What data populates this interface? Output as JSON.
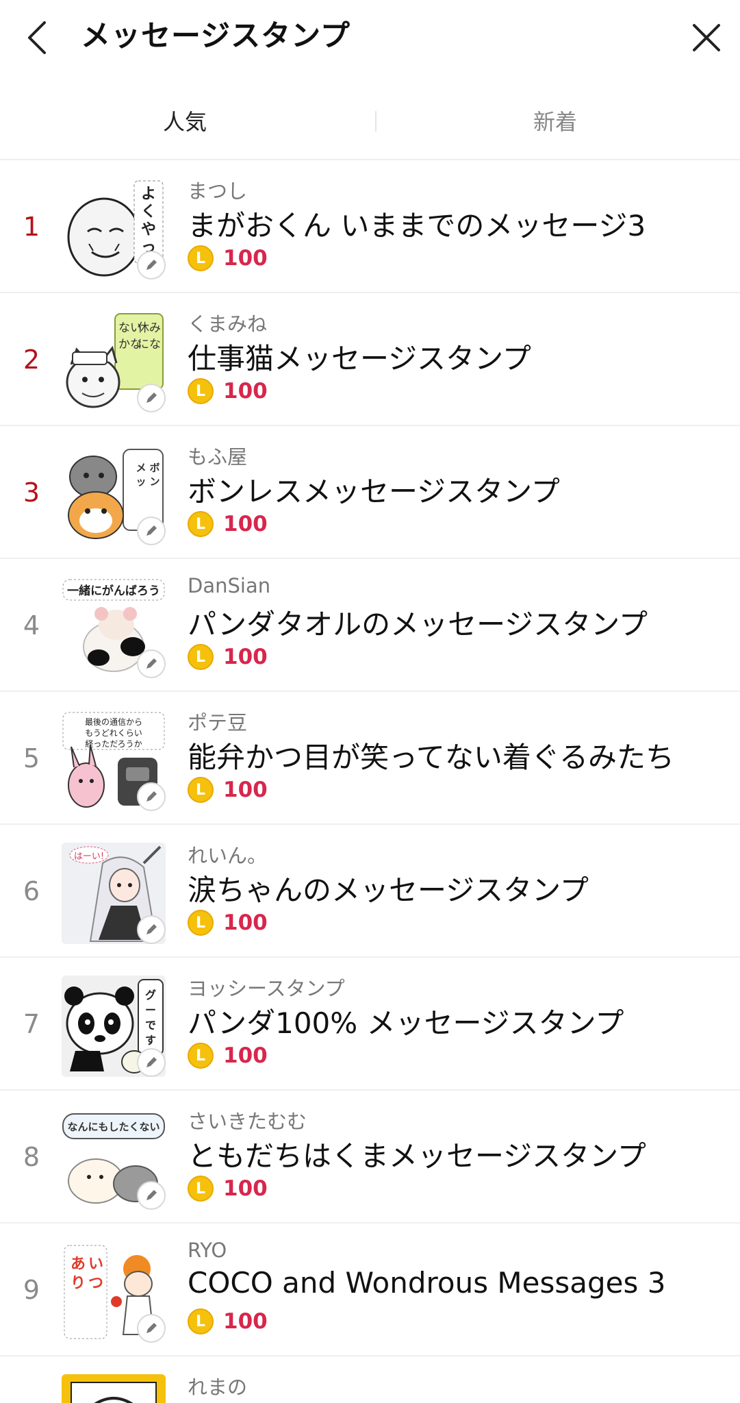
{
  "header": {
    "title": "メッセージスタンプ"
  },
  "tabs": [
    {
      "label": "人気",
      "active": true
    },
    {
      "label": "新着",
      "active": false
    }
  ],
  "colors": {
    "rank_top": "#b5121b",
    "rank_default": "#8a8a8a",
    "price": "#d8264c",
    "coin": "#f6c10c"
  },
  "items": [
    {
      "rank": "1",
      "author": "まつし",
      "name": "まがおくん いままでのメッセージ3",
      "price": "100",
      "coin_symbol": "L",
      "thumb": "bald-face-sticker"
    },
    {
      "rank": "2",
      "author": "くまみね",
      "name": "仕事猫メッセージスタンプ",
      "price": "100",
      "coin_symbol": "L",
      "thumb": "work-cat-sticker"
    },
    {
      "rank": "3",
      "author": "もふ屋",
      "name": "ボンレスメッセージスタンプ",
      "price": "100",
      "coin_symbol": "L",
      "thumb": "boneless-cat-sticker"
    },
    {
      "rank": "4",
      "author": "DanSian",
      "name": "パンダタオルのメッセージスタンプ",
      "price": "100",
      "coin_symbol": "L",
      "thumb": "panda-towel-sticker"
    },
    {
      "rank": "5",
      "author": "ポテ豆",
      "name": "能弁かつ目が笑ってない着ぐるみたち",
      "price": "100",
      "coin_symbol": "L",
      "thumb": "costume-rabbit-sticker"
    },
    {
      "rank": "6",
      "author": "れいん。",
      "name": "涙ちゃんのメッセージスタンプ",
      "price": "100",
      "coin_symbol": "L",
      "thumb": "anime-girl-sticker"
    },
    {
      "rank": "7",
      "author": "ヨッシースタンプ",
      "name": "パンダ100% メッセージスタンプ",
      "price": "100",
      "coin_symbol": "L",
      "thumb": "panda-sticker"
    },
    {
      "rank": "8",
      "author": "さいきたむむ",
      "name": "ともだちはくまメッセージスタンプ",
      "price": "100",
      "coin_symbol": "L",
      "thumb": "bear-friend-sticker"
    },
    {
      "rank": "9",
      "author": "RYO",
      "name": "COCO and Wondrous Messages 3",
      "price": "100",
      "coin_symbol": "L",
      "thumb": "coco-girl-sticker"
    },
    {
      "rank": "",
      "author": "れまの",
      "name": "",
      "price": "",
      "coin_symbol": "L",
      "thumb": "partial-sticker"
    }
  ],
  "thumb_text": {
    "t1": "よくやっ",
    "t2": "休みになんないかなあ",
    "t3": "ボンレスメッセージスタンプ",
    "t4": "一緒にがんばろう",
    "t5": "最後の通信からもうどれくらい経っただろうか",
    "t6": "はーい！",
    "t7": "グーです。",
    "t8": "なんにもしたくない",
    "t9": "いつもありがとう"
  }
}
